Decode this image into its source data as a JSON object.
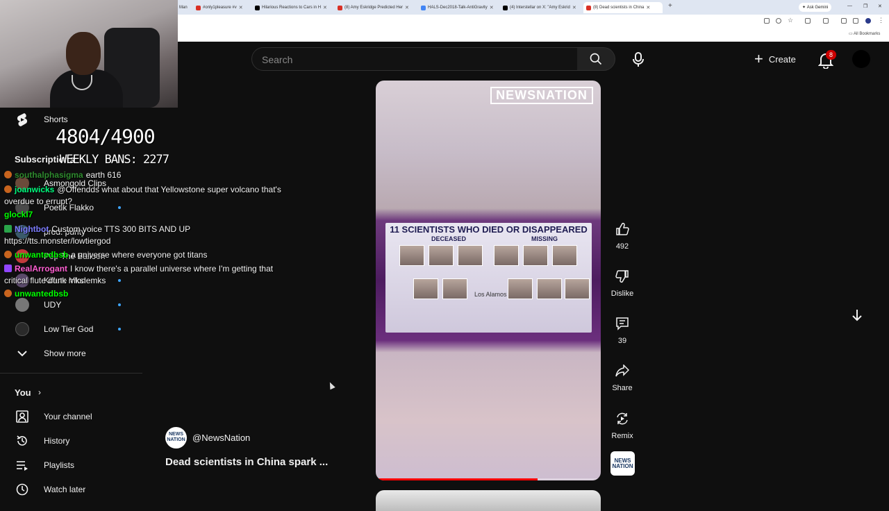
{
  "browser": {
    "tabs": [
      {
        "label": "Man",
        "color": "#888888"
      },
      {
        "label": "#only1pleasure #v",
        "color": "#d93025"
      },
      {
        "label": "Hilarious Reactions to Cars in H",
        "color": "#000000"
      },
      {
        "label": "(8) Amy Eskridge Predicted Her",
        "color": "#d93025"
      },
      {
        "label": "HALS-Dec2018-Talk-AntiGravity",
        "color": "#4285f4"
      },
      {
        "label": "(4) Interstellar on X: \"Amy Eskrid",
        "color": "#000000"
      },
      {
        "label": "(8) Dead scientists in China",
        "color": "#d93025"
      }
    ],
    "new_tab": "+",
    "ask_gemini": "Ask Gemini",
    "all_bookmarks": "All Bookmarks"
  },
  "stream_overlay": {
    "counter": "4804/4900",
    "weekly_bans": "WEEKLY BANS: 2277",
    "chat": [
      {
        "user": "southalphasigma",
        "user_color": "#2e8b2e",
        "text": "earth 616"
      },
      {
        "user": "joanwicks",
        "user_color": "#00ff7f",
        "text": "@Offendds what about that Yellowstone super volcano that's overdue to errupt?"
      },
      {
        "user": "glockl7",
        "user_color": "#00ff00",
        "text": ""
      },
      {
        "user": "Nightbot",
        "user_color": "#7c7cff",
        "text": "Custom voice TTS 300 BITS AND UP https://tts.monster/lowtiergod"
      },
      {
        "user": "unwantedbsb",
        "user_color": "#00ff00",
        "text": "a universe where everyone got titans"
      },
      {
        "user": "RealArrogant",
        "user_color": "#ff5fd2",
        "text": "I know there's a parallel universe where I'm getting that critical flute dunk mks"
      },
      {
        "user": "unwantedbsb",
        "user_color": "#00ff00",
        "text": ""
      }
    ]
  },
  "youtube": {
    "search_placeholder": "Search",
    "create_label": "Create",
    "notification_count": "8",
    "sidebar": {
      "shorts": "Shorts",
      "subscriptions_title": "Subscriptions",
      "subscriptions": [
        {
          "name": "Asmongold Clips",
          "color": "#6b4a3a",
          "dot": false
        },
        {
          "name": "Poetik Flakko",
          "color": "#4a4a4a",
          "dot": true
        },
        {
          "name": "prod. purity",
          "color": "#3a5a6a",
          "dot": false
        },
        {
          "name": "Pop The Balloon",
          "color": "#c23b3b",
          "dot": false
        },
        {
          "name": "Kiflute Vlodemks",
          "color": "#5a4a6a",
          "dot": true
        },
        {
          "name": "UDY",
          "color": "#777777",
          "dot": true
        },
        {
          "name": "Low Tier God",
          "color": "#2a2a2a",
          "dot": true
        }
      ],
      "show_more": "Show more",
      "you_title": "You",
      "you_items": [
        "Your channel",
        "History",
        "Playlists",
        "Watch later"
      ]
    },
    "short": {
      "overlay_logo": "NEWSNATION",
      "graphic_title": "11 SCIENTISTS WHO DIED OR DISAPPEARED",
      "deceased": "DECEASED",
      "missing": "MISSING",
      "location_text": "Los Alamos",
      "progress": 0.72,
      "channel_handle": "@NewsNation",
      "channel_avatar_text": "NEWS NATION",
      "title": "Dead scientists in China spark ..."
    },
    "actions": {
      "likes": "492",
      "dislike": "Dislike",
      "comments": "39",
      "share": "Share",
      "remix": "Remix"
    }
  }
}
